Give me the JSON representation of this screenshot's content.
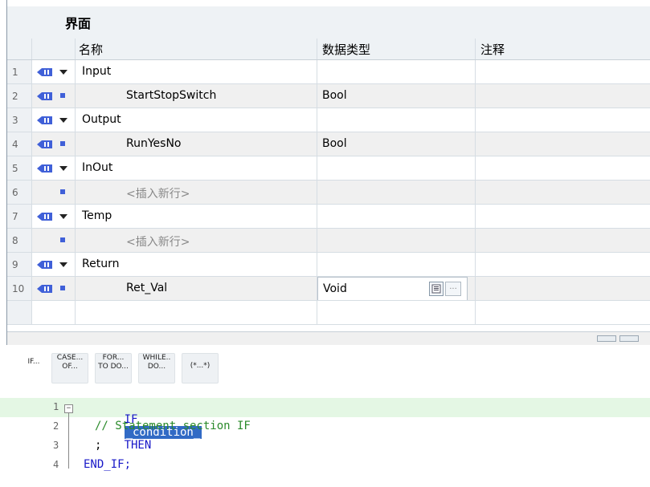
{
  "interface": {
    "title": "界面",
    "columns": {
      "name": "名称",
      "data_type": "数据类型",
      "comment": "注释"
    },
    "rows": [
      {
        "num": "1",
        "name": "Input",
        "kind": "section",
        "type": "",
        "comment": ""
      },
      {
        "num": "2",
        "name": "StartStopSwitch",
        "kind": "param",
        "type": "Bool",
        "comment": ""
      },
      {
        "num": "3",
        "name": "Output",
        "kind": "section",
        "type": "",
        "comment": ""
      },
      {
        "num": "4",
        "name": "RunYesNo",
        "kind": "param",
        "type": "Bool",
        "comment": ""
      },
      {
        "num": "5",
        "name": "InOut",
        "kind": "section",
        "type": "",
        "comment": ""
      },
      {
        "num": "6",
        "name": "<插入新行>",
        "kind": "placeholder",
        "type": "",
        "comment": ""
      },
      {
        "num": "7",
        "name": "Temp",
        "kind": "section",
        "type": "",
        "comment": ""
      },
      {
        "num": "8",
        "name": "<插入新行>",
        "kind": "placeholder",
        "type": "",
        "comment": ""
      },
      {
        "num": "9",
        "name": "Return",
        "kind": "section",
        "type": "",
        "comment": ""
      },
      {
        "num": "10",
        "name": "Ret_Val",
        "kind": "param-edit",
        "type": "Void",
        "comment": ""
      }
    ],
    "browse_button": "..."
  },
  "toolbar": {
    "buttons": [
      {
        "label": "IF..."
      },
      {
        "label": "CASE...\nOF..."
      },
      {
        "label": "FOR...\nTO DO..."
      },
      {
        "label": "WHILE..\nDO..."
      },
      {
        "label": "(*...*)"
      }
    ]
  },
  "editor": {
    "lines": [
      {
        "num": "1",
        "kw1": "IF",
        "sel": "_condition_",
        "kw2": "THEN"
      },
      {
        "num": "2",
        "comment": "// Statement section IF"
      },
      {
        "num": "3",
        "text": ";"
      },
      {
        "num": "4",
        "kw1": "END_IF;"
      }
    ]
  },
  "colors": {
    "section_blue": "#4060d8",
    "keyword": "#1818c8",
    "comment": "#2a8a2a",
    "selection": "#316ac5",
    "active_line": "#e4f7e4"
  }
}
